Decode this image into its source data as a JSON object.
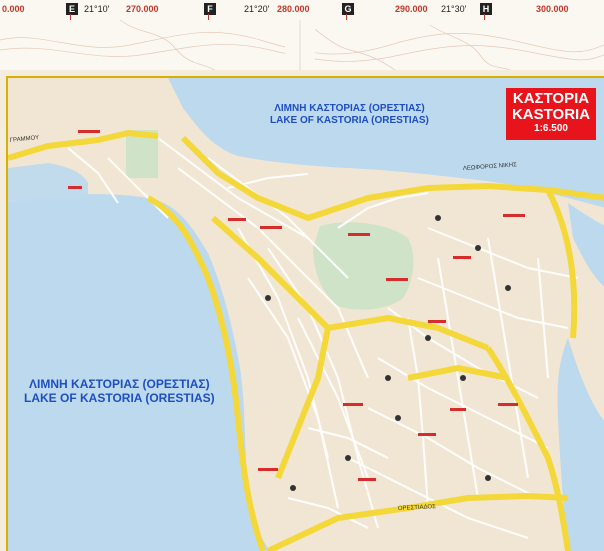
{
  "ruler": {
    "grid_letters": [
      "E",
      "F",
      "G",
      "H"
    ],
    "eastings": [
      "0.000",
      "270.000",
      "280.000",
      "290.000",
      "300.000"
    ],
    "longitudes": [
      "21°10'",
      "21°20'",
      "21°30'"
    ]
  },
  "title": {
    "greek": "ΚΑΣΤΟΡΙΑ",
    "latin": "KASTORIA",
    "scale": "1:6.500"
  },
  "lakes": {
    "north": {
      "greek": "ΛΙΜΝΗ ΚΑΣΤΟΡΙΑΣ (ΟΡΕΣΤΙΑΣ)",
      "latin": "LAKE OF KASTORIA (ORESTIAS)"
    },
    "south": {
      "greek": "ΛΙΜΝΗ ΚΑΣΤΟΡΙΑΣ (ΟΡΕΣΤΙΑΣ)",
      "latin": "LAKE OF KASTORIA (ORESTIAS)"
    }
  },
  "streets": {
    "leoforos_nikis": "ΛΕΩΦΟΡΟΣ ΝΙΚΗΣ",
    "orestiados": "ΟΡΕΣΤΙΑΔΟΣ",
    "grammou": "ΓΡΑΜΜΟΥ"
  },
  "colors": {
    "lake": "#bcd9ee",
    "land": "#f1e6d3",
    "main_road": "#f4d83a",
    "park": "#cfe3c9",
    "accent": "#e8141b"
  }
}
